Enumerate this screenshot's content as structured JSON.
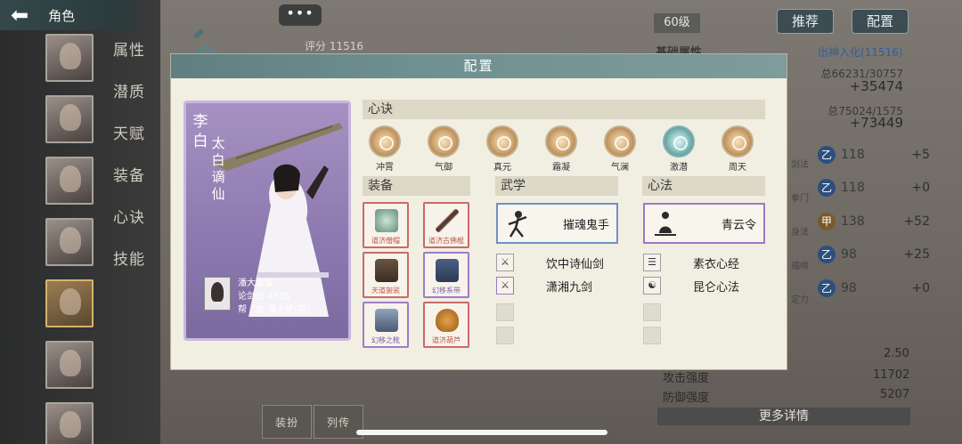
{
  "header": {
    "title": "角色"
  },
  "side_menu": [
    "属性",
    "潜质",
    "天赋",
    "装备",
    "心诀",
    "技能"
  ],
  "top": {
    "more_dots": "•••",
    "score_label": "评分 11516",
    "level": "60级",
    "recommend_btn": "推荐",
    "config_btn": "配置"
  },
  "right_panel": {
    "title": "基础属性",
    "realm_link": "出神入化(11516)",
    "total1": "总66231/30757",
    "big1": "+35474",
    "total2": "总75024/1575",
    "big2": "+73449",
    "stats": [
      {
        "label": "剑法",
        "icon": "乙",
        "value": "118",
        "delta": "+5"
      },
      {
        "label": "拳门",
        "icon": "乙",
        "value": "118",
        "delta": "+0"
      },
      {
        "label": "身法",
        "icon": "甲",
        "value": "138",
        "delta": "+52"
      },
      {
        "label": "福缘",
        "icon": "乙",
        "value": "98",
        "delta": "+25"
      },
      {
        "label": "定力",
        "icon": "乙",
        "value": "98",
        "delta": "+0"
      }
    ],
    "bottom_value1": "2.50",
    "attack_label": "攻击强度",
    "attack_value": "11702",
    "defense_label": "防御强度",
    "defense_value": "5207",
    "more_details": "更多详情"
  },
  "bottom_tabs": [
    "装扮",
    "列传"
  ],
  "modal": {
    "title": "配置",
    "character": {
      "name": "李白",
      "title": "太白谪仙",
      "player_name": "潘大宝宝",
      "sword_score": "论剑分 4505",
      "guild": "帮　会 潘大堡(苗)"
    },
    "xinjue_header": "心诀",
    "xinjue": [
      {
        "label": "冲霄",
        "icon": "chongxiao-icon",
        "tone": "gold"
      },
      {
        "label": "气御",
        "icon": "qiyu-icon",
        "tone": "gold"
      },
      {
        "label": "真元",
        "icon": "zhenyuan-icon",
        "tone": "gold"
      },
      {
        "label": "霜凝",
        "icon": "shuangning-icon",
        "tone": "gold"
      },
      {
        "label": "气澜",
        "icon": "qilan-icon",
        "tone": "gold"
      },
      {
        "label": "激潜",
        "icon": "jiqian-icon",
        "tone": "blue"
      },
      {
        "label": "周天",
        "icon": "zhoutian-icon",
        "tone": "gold"
      }
    ],
    "equip_header": "装备",
    "equipment": [
      {
        "label": "道济僧帽",
        "tone": "red"
      },
      {
        "label": "道济古佛棍",
        "tone": "red"
      },
      {
        "label": "天道袈裟",
        "tone": "red"
      },
      {
        "label": "幻移系带",
        "tone": "purple"
      },
      {
        "label": "幻移之靴",
        "tone": "purple"
      },
      {
        "label": "道济葫芦",
        "tone": "red"
      }
    ],
    "wuxue_header": "武学",
    "wuxue_main": "摧魂鬼手",
    "wuxue_sub": [
      "饮中诗仙剑",
      "潇湘九剑"
    ],
    "xinfa_header": "心法",
    "xinfa_main": "青云令",
    "xinfa_sub": [
      "素衣心经",
      "昆仑心法"
    ]
  }
}
